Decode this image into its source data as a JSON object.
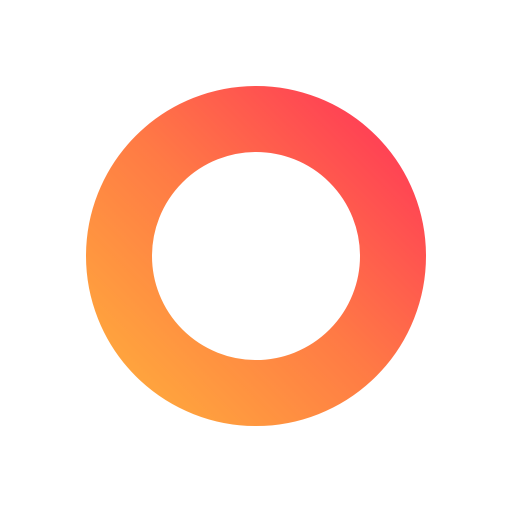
{
  "logo": {
    "icon_name": "ring-logo-icon",
    "background_color": "#ffffff",
    "gradient": {
      "start_color": "#ffa63d",
      "mid_color": "#ff7a45",
      "end_color": "#ff3f55"
    }
  }
}
